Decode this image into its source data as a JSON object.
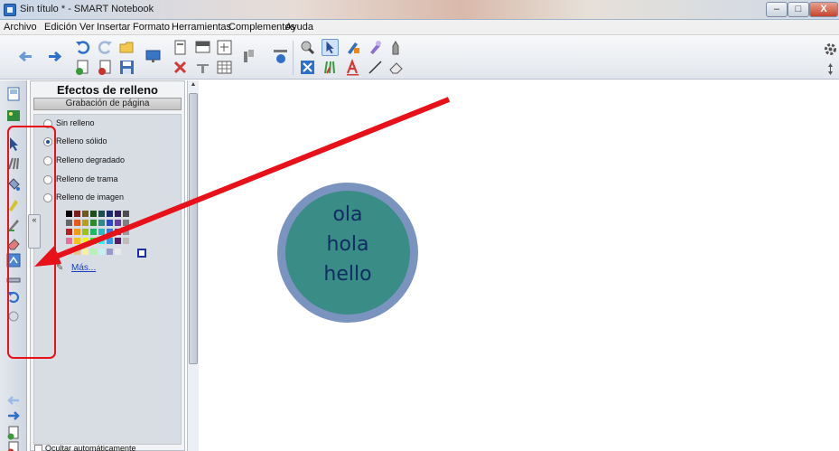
{
  "window": {
    "title": "Sin título * - SMART Notebook",
    "minimize": "–",
    "maximize": "□",
    "close": "X"
  },
  "menu": [
    "Archivo",
    "Edición",
    "Ver",
    "Insertar",
    "Formato",
    "Herramientas",
    "Complementos",
    "Ayuda"
  ],
  "panel": {
    "title": "Efectos de relleno",
    "subtitle": "Grabación de página",
    "options": [
      {
        "label": "Sin relleno",
        "selected": false
      },
      {
        "label": "Relleno sólido",
        "selected": true
      },
      {
        "label": "Relleno degradado",
        "selected": false
      },
      {
        "label": "Relleno de trama",
        "selected": false
      },
      {
        "label": "Relleno de imagen",
        "selected": false
      }
    ],
    "more_link": "Más...",
    "collapse_label": "«",
    "hide_checkbox_label": "Ocultar automáticamente"
  },
  "canvas": {
    "circle_lines": [
      "ola",
      "hola",
      "hello"
    ],
    "circle_fill": "#3a8c86",
    "circle_border": "#7a93bf",
    "text_color": "#0f2d62"
  },
  "annotation": {
    "arrow_color": "#e8111a",
    "highlight_color": "#e8111a"
  },
  "icons": {
    "toolbar": [
      "back-icon",
      "forward-icon",
      "undo-icon",
      "redo-icon",
      "open-icon",
      "add-page-icon",
      "delete-page-icon",
      "save-icon",
      "screen-share-icon",
      "paste-icon",
      "delete-icon",
      "screen-shade-icon",
      "table-icon",
      "doc-camera-icon",
      "full-screen-icon",
      "pen-tools-icon",
      "select-icon",
      "color-pen-icon",
      "highlighter-icon",
      "eraser-icon",
      "text-icon",
      "line-icon",
      "shapes-icon",
      "settings-icon",
      "move-toolbar-icon"
    ]
  }
}
